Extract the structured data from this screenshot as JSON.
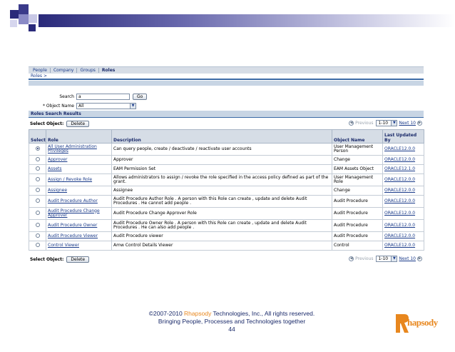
{
  "tabs": [
    {
      "label": "People"
    },
    {
      "label": "Company"
    },
    {
      "label": "Groups"
    },
    {
      "label": "Roles"
    }
  ],
  "breadcrumb": "Roles  >",
  "search": {
    "label": "Search",
    "value": "a",
    "go_label": "Go",
    "object_name_label": "* Object Name",
    "object_name_value": "All"
  },
  "results": {
    "header": "Roles Search Results",
    "select_object_label": "Select Object:",
    "delete_label": "Delete",
    "pager": {
      "previous": "Previous",
      "range": "1-10",
      "next": "Next 10"
    }
  },
  "table": {
    "columns": {
      "select": "Select",
      "role": "Role",
      "description": "Description",
      "object_name": "Object Name",
      "last_updated_by": "Last Updated By"
    },
    "rows": [
      {
        "role": "All User Administration Privileges",
        "description": "Can query people, create / deactivate / reactivate user accounts",
        "object_name": "User Management Person",
        "updated": "ORACLE12.0.0",
        "selected": true
      },
      {
        "role": "Approver",
        "description": "Approver",
        "object_name": "Change",
        "updated": "ORACLE12.0.0",
        "selected": false
      },
      {
        "role": "Assets",
        "description": "EAM Permission Set",
        "object_name": "EAM Assets Object",
        "updated": "ORACLE12.1.0",
        "selected": false
      },
      {
        "role": "Assign / Revoke Role",
        "description": "Allows administrators to assign / revoke the role specified in the access policy defined as part of the grant.",
        "object_name": "User Management Role",
        "updated": "ORACLE12.0.0",
        "selected": false
      },
      {
        "role": "Assignee",
        "description": "Assignee",
        "object_name": "Change",
        "updated": "ORACLE12.0.0",
        "selected": false
      },
      {
        "role": "Audit Procedure Author",
        "description": "Audit Procedure Author Role . A person with this Role can create , update and delete Audit Procedures . He cannot add people .",
        "object_name": "Audit Procedure",
        "updated": "ORACLE12.0.0",
        "selected": false
      },
      {
        "role": "Audit Procedure Change Approver",
        "description": "Audit Procedure Change Approver Role",
        "object_name": "Audit Procedure",
        "updated": "ORACLE12.0.0",
        "selected": false
      },
      {
        "role": "Audit Procedure Owner",
        "description": "Audit Procedure Owner Role . A person with this Role can create , update and delete Audit Procedures . He can also add people .",
        "object_name": "Audit Procedure",
        "updated": "ORACLE12.0.0",
        "selected": false
      },
      {
        "role": "Audit Procedure Viewer",
        "description": "Audit Procedure viewer",
        "object_name": "Audit Procedure",
        "updated": "ORACLE12.0.0",
        "selected": false
      },
      {
        "role": "Control Viewer",
        "description": "Amw Control Details Viewer",
        "object_name": "Control",
        "updated": "ORACLE12.0.0",
        "selected": false
      }
    ]
  },
  "footer": {
    "copyright_pre": "©2007-2010 ",
    "brand": "Rhapsody",
    "copyright_post": " Technologies, Inc., All rights reserved.",
    "tagline": "Bringing People, Processes and Technologies together",
    "page_number": "44"
  },
  "logo_text": "Rhapsody",
  "colors": {
    "accent": "#e8871e",
    "navy": "#1a2a6a",
    "link": "#1a3b8a"
  }
}
